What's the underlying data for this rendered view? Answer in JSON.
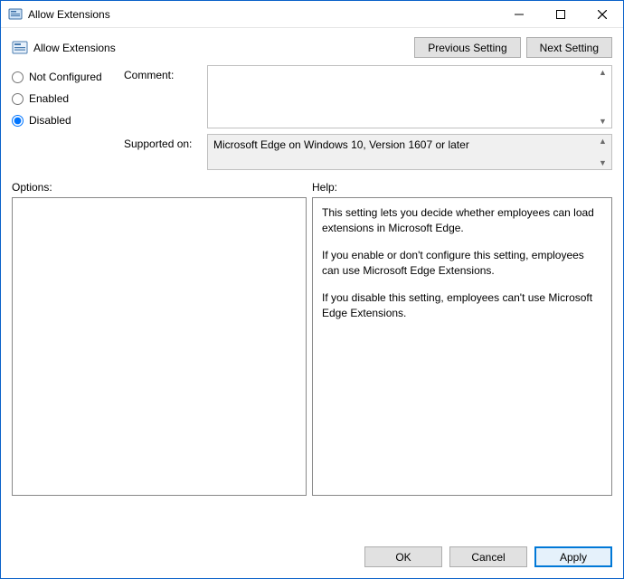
{
  "window": {
    "title": "Allow Extensions"
  },
  "header": {
    "policy_name": "Allow Extensions",
    "previous_label": "Previous Setting",
    "next_label": "Next Setting"
  },
  "state": {
    "not_configured_label": "Not Configured",
    "enabled_label": "Enabled",
    "disabled_label": "Disabled",
    "selected": "disabled"
  },
  "comment": {
    "label": "Comment:",
    "value": ""
  },
  "supported": {
    "label": "Supported on:",
    "value": "Microsoft Edge on Windows 10, Version 1607 or later"
  },
  "options": {
    "label": "Options:"
  },
  "help": {
    "label": "Help:",
    "paragraphs": [
      "This setting lets you decide whether employees can load extensions in Microsoft Edge.",
      "If you enable or don't configure this setting, employees can use Microsoft Edge Extensions.",
      "If you disable this setting, employees can't use Microsoft Edge Extensions."
    ]
  },
  "buttons": {
    "ok": "OK",
    "cancel": "Cancel",
    "apply": "Apply"
  }
}
